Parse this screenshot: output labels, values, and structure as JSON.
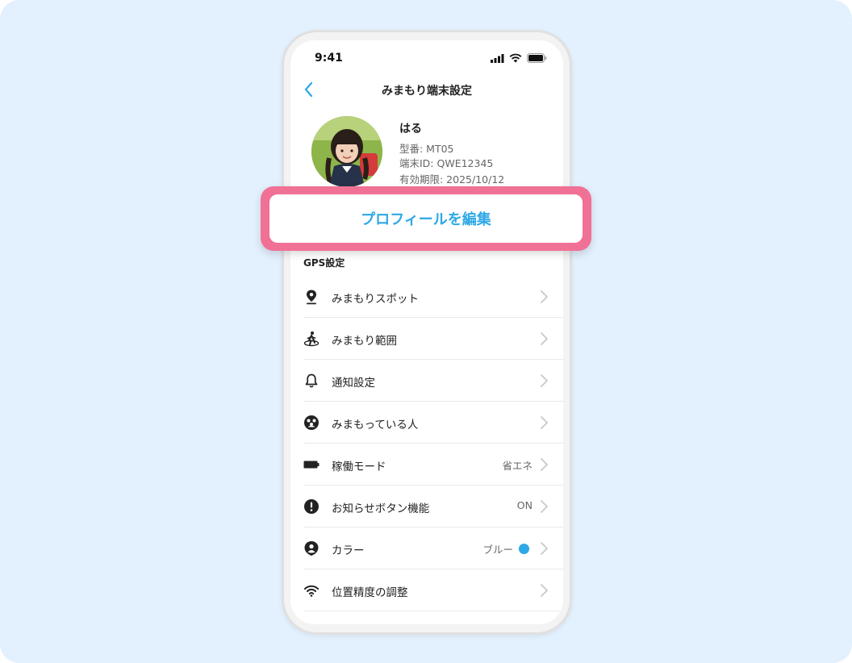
{
  "status": {
    "time": "9:41"
  },
  "nav": {
    "title": "みまもり端末設定"
  },
  "profile": {
    "name": "はる",
    "model": "型番: MT05",
    "device_id": "端末ID: QWE12345",
    "expiry": "有効期限: 2025/10/12"
  },
  "edit_button": {
    "label": "プロフィールを編集"
  },
  "section": {
    "label": "GPS設定"
  },
  "menu": {
    "items": [
      {
        "label": "みまもりスポット",
        "icon": "location-pin-icon",
        "value": ""
      },
      {
        "label": "みまもり範囲",
        "icon": "walking-area-icon",
        "value": ""
      },
      {
        "label": "通知設定",
        "icon": "bell-icon",
        "value": ""
      },
      {
        "label": "みまもっている人",
        "icon": "people-group-icon",
        "value": ""
      },
      {
        "label": "稼働モード",
        "icon": "battery-icon",
        "value": "省エネ"
      },
      {
        "label": "お知らせボタン機能",
        "icon": "alert-icon",
        "value": "ON"
      },
      {
        "label": "カラー",
        "icon": "person-badge-icon",
        "value": "ブルー",
        "dot_color": "#2ea8e6"
      },
      {
        "label": "位置精度の調整",
        "icon": "wifi-icon",
        "value": ""
      }
    ]
  },
  "colors": {
    "accent": "#2ea8e6",
    "highlight": "#f07195",
    "background": "#e3f0fd"
  }
}
